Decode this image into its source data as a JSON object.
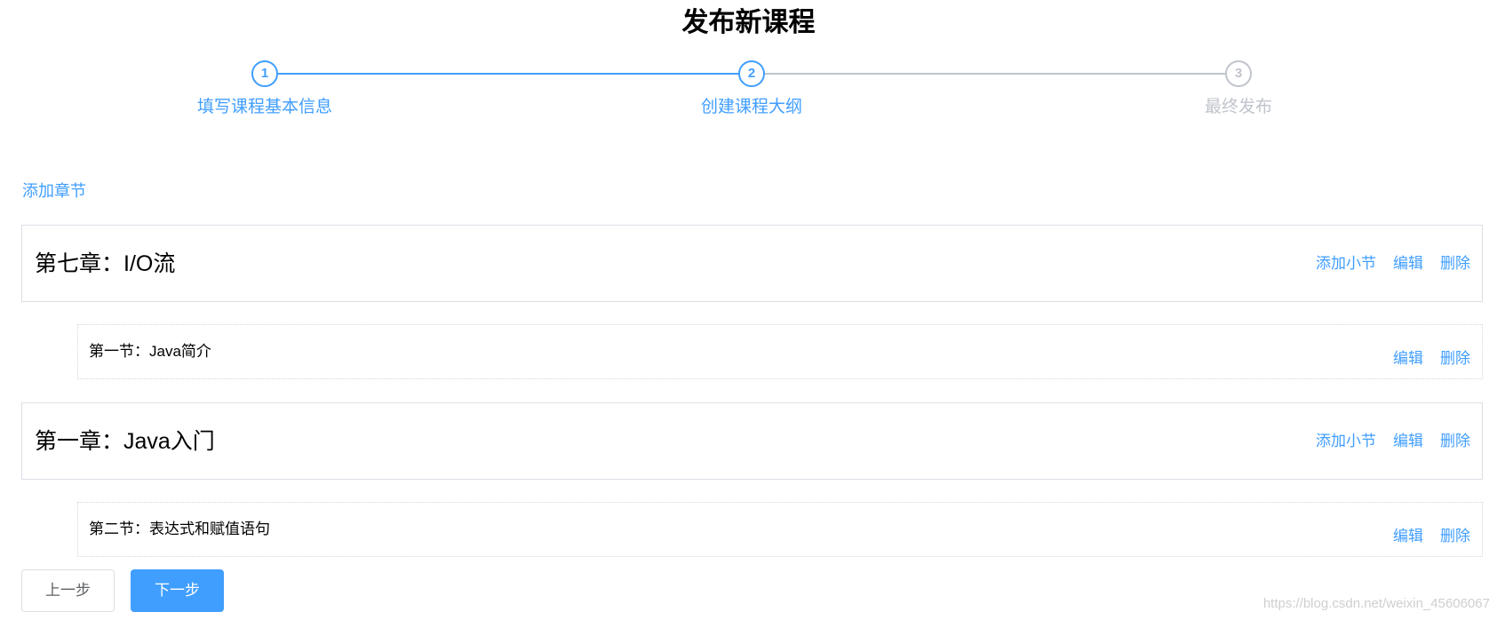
{
  "page": {
    "title": "发布新课程"
  },
  "steps": [
    {
      "number": "1",
      "label": "填写课程基本信息",
      "active": true
    },
    {
      "number": "2",
      "label": "创建课程大纲",
      "active": true
    },
    {
      "number": "3",
      "label": "最终发布",
      "active": false
    }
  ],
  "outline": {
    "add_chapter_label": "添加章节",
    "chapters": [
      {
        "title": "第七章：I/O流",
        "add_section_label": "添加小节",
        "edit_label": "编辑",
        "delete_label": "删除",
        "sections": [
          {
            "title": "第一节：Java简介",
            "edit_label": "编辑",
            "delete_label": "删除"
          }
        ]
      },
      {
        "title": "第一章：Java入门",
        "add_section_label": "添加小节",
        "edit_label": "编辑",
        "delete_label": "删除",
        "sections": [
          {
            "title": "第二节：表达式和赋值语句",
            "edit_label": "编辑",
            "delete_label": "删除"
          }
        ]
      }
    ]
  },
  "footer": {
    "prev_label": "上一步",
    "next_label": "下一步"
  },
  "watermark": "https://blog.csdn.net/weixin_45606067",
  "colors": {
    "primary": "#409EFF",
    "inactive": "#C0C4CC",
    "text": "#303133",
    "border": "#DCDFE6",
    "button_text": "#606266"
  }
}
